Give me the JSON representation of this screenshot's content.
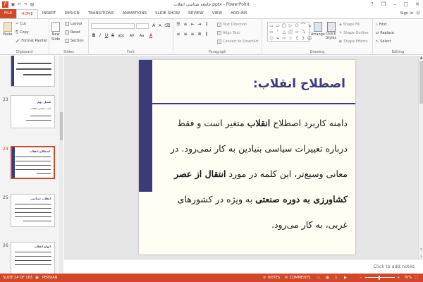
{
  "titlebar": {
    "app_icon": "P",
    "title": "جامعه شناسی انقلاب.pptx - PowerPoint",
    "qat": [
      "save-icon",
      "undo-icon",
      "redo-icon",
      "start-icon"
    ],
    "controls": {
      "help": "?",
      "restore": "❐",
      "minimize": "–",
      "maximize": "□",
      "close": "✕"
    }
  },
  "tabs": [
    "FILE",
    "HOME",
    "INSERT",
    "DESIGN",
    "TRANSITIONS",
    "ANIMATIONS",
    "SLIDE SHOW",
    "REVIEW",
    "VIEW",
    "ADD-INS"
  ],
  "signin": "Sign in",
  "ribbon": {
    "clipboard": {
      "paste": "Paste",
      "cut": "Cut",
      "copy": "Copy",
      "format_painter": "Format Painter",
      "label": "Clipboard"
    },
    "slides": {
      "new_slide": "New",
      "new_slide2": "Slide",
      "layout": "Layout",
      "reset": "Reset",
      "section": "Section",
      "label": "Slides"
    },
    "font": {
      "label": "Font",
      "bold": "B",
      "italic": "I",
      "underline": "U",
      "strike": "S",
      "shadow": "abc",
      "spacing": "AV",
      "case": "Aa",
      "color": "A",
      "grow": "A",
      "shrink": "A"
    },
    "paragraph": {
      "text_direction": "Text Direction",
      "align_text": "Align Text",
      "smartart": "Convert to SmartArt",
      "label": "Paragraph"
    },
    "drawing": {
      "arrange": "Arrange",
      "quick_styles": "Quick",
      "quick_styles2": "Styles",
      "shape_fill": "Shape Fill",
      "shape_outline": "Shape Outline",
      "shape_effects": "Shape Effects",
      "label": "Drawing",
      "shapes": [
        "▭",
        "▭",
        "◯",
        "▷",
        "⬠",
        "⌒",
        "↘",
        "▭",
        "⌜",
        "△",
        "⬜",
        "▱",
        "⤵",
        "⌢",
        "⬡",
        "↳",
        "⇨",
        "☆",
        "{",
        "}",
        "☺"
      ]
    },
    "editing": {
      "find": "Find",
      "replace": "Replace",
      "select": "Select",
      "label": "Editing"
    }
  },
  "thumbnails": [
    {
      "num": "",
      "title": "",
      "selected": false
    },
    {
      "num": "23",
      "title": "فصل دوم",
      "sub": "ثبات سیاسی انقلاب",
      "selected": false
    },
    {
      "num": "24",
      "title": "اصطلاح انقلاب",
      "sub": "",
      "selected": true
    },
    {
      "num": "25",
      "title": "انقلاب سیاسی",
      "sub": "",
      "selected": false
    },
    {
      "num": "26",
      "title": "انواع انقلاب",
      "sub": "",
      "selected": false
    }
  ],
  "slide": {
    "title": "اصطلاح انقلاب:",
    "lines": [
      {
        "parts": [
          {
            "t": "دامنه کاربرد اصطلاح ",
            "b": false
          },
          {
            "t": "انقلاب",
            "b": true
          },
          {
            "t": " متغیر است و فقط",
            "b": false
          }
        ]
      },
      {
        "parts": [
          {
            "t": "درباره تغییرات سیاسی بنیادین به کار نمی‌رود. در",
            "b": false
          }
        ]
      },
      {
        "parts": [
          {
            "t": "معانی وسیع‌تر، این کلمه در مورد ",
            "b": false
          },
          {
            "t": "انتقال از عصر",
            "b": true
          }
        ]
      },
      {
        "parts": [
          {
            "t": "کشاورزی به دوره صنعتی",
            "b": true
          },
          {
            "t": " به ویژه در کشورهای",
            "b": false
          }
        ]
      },
      {
        "parts": [
          {
            "t": "غربی، به کار می‌رود.",
            "b": false
          }
        ]
      }
    ]
  },
  "notes_placeholder": "Click to add notes",
  "status": {
    "slide_of": "SLIDE 24 OF 183",
    "language": "PERSIAN",
    "notes": "NOTES",
    "comments": "COMMENTS",
    "zoom": "70%"
  }
}
